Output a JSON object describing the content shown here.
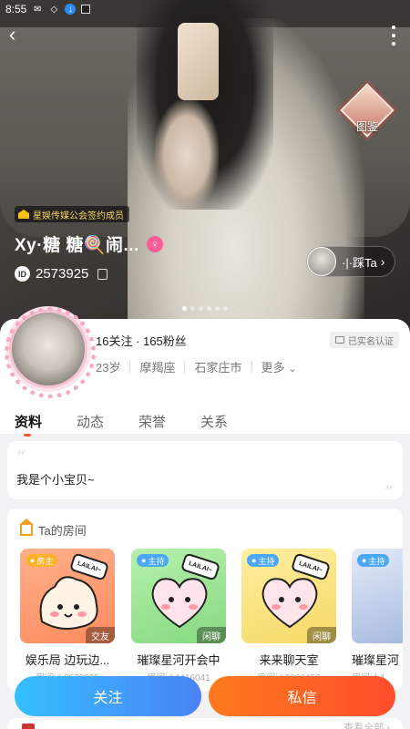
{
  "status_bar": {
    "time": "8:55"
  },
  "hero": {
    "emblem_label": "图鉴",
    "guild_label": "星娱传媒公会签约成员",
    "name": "Xy·糖 糖🍭闹...",
    "gender_symbol": "♀",
    "id_badge": "ID",
    "id_number": "2573925",
    "step_label": "·|·踩Ta",
    "step_chevron": "›"
  },
  "profile": {
    "follow_info": "16关注 · 165粉丝",
    "verified_label": "已实名认证",
    "age": "23岁",
    "constellation": "摩羯座",
    "city": "石家庄市",
    "more_label": "更多",
    "more_chevron": "⌄"
  },
  "tabs": [
    {
      "label": "资料",
      "active": true
    },
    {
      "label": "动态",
      "active": false
    },
    {
      "label": "荣誉",
      "active": false
    },
    {
      "label": "关系",
      "active": false
    }
  ],
  "bio": {
    "text": "我是个小宝贝~"
  },
  "rooms": {
    "header": "Ta的房间",
    "items": [
      {
        "role": "房主",
        "category": "交友",
        "title": "娱乐局 边玩边...",
        "room_id": "房间id:2573925",
        "bubble": "LAILAI~",
        "bg": "#ff9a76"
      },
      {
        "role": "主持",
        "category": "闲聊",
        "title": "璀璨星河开会中",
        "room_id": "房间id:4416041",
        "bubble": "LAILAI~",
        "bg": "#9ee39a"
      },
      {
        "role": "主持",
        "category": "闲聊",
        "title": "来来聊天室",
        "room_id": "房间id:3026453",
        "bubble": "LAILAI~",
        "bg": "#f9e27a"
      },
      {
        "role": "主持",
        "category": "",
        "title": "璀璨星河",
        "room_id": "房间id:4",
        "bubble": "",
        "bg": "#c9d7ef"
      }
    ]
  },
  "actions": {
    "follow": "关注",
    "message": "私信"
  },
  "peek": {
    "more_text": "查看全部 ›"
  },
  "colors": {
    "accent_orange": "#ff5a2c",
    "follow_blue": "#4a82f6"
  }
}
